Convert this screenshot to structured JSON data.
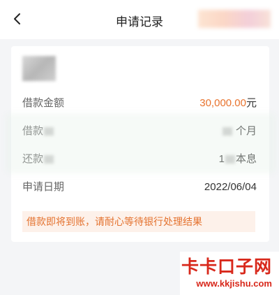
{
  "header": {
    "title": "申请记录",
    "back_icon": "chevron-left-icon"
  },
  "record": {
    "rows": [
      {
        "label": "借款金额",
        "value": "30,000.00",
        "unit": "元"
      },
      {
        "label": "借款",
        "value": "个月"
      },
      {
        "label": "还款",
        "value": "1",
        "unit": "本息"
      },
      {
        "label": "申请日期",
        "value": "2022/06/04"
      }
    ],
    "notice": "借款即将到账，请耐心等待银行处理结果"
  },
  "watermark": {
    "name": "卡卡口子网",
    "url": "www.kkjishu.com"
  },
  "colors": {
    "accent_orange": "#e8732e",
    "notice_bg": "#fdf1ea",
    "brand_red": "#d8281b"
  }
}
